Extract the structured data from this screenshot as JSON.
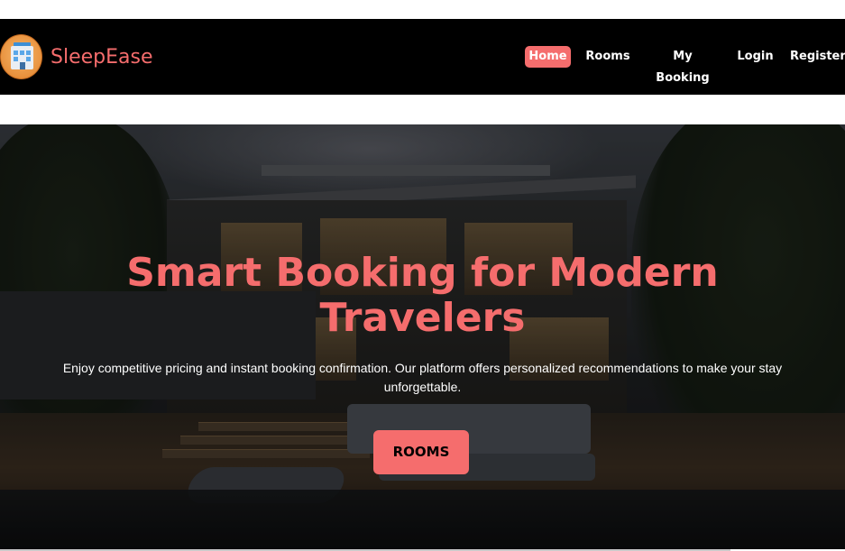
{
  "brand": {
    "name": "SleepEase",
    "logo_icon": "hotel-building-icon"
  },
  "nav": {
    "items": [
      {
        "label": "Home",
        "active": true
      },
      {
        "label": "Rooms",
        "active": false
      },
      {
        "label": "My Booking",
        "active": false
      },
      {
        "label": "Login",
        "active": false
      },
      {
        "label": "Register",
        "active": false
      }
    ]
  },
  "hero": {
    "title": "Smart Booking for Modern Travelers",
    "subtitle": "Enjoy competitive pricing and instant booking confirmation. Our platform offers personalized recommendations to make your stay unforgettable.",
    "cta_label": "ROOMS"
  },
  "colors": {
    "accent": "#f56d6d",
    "navbar_bg": "#000000",
    "text_light": "#ffffff"
  }
}
